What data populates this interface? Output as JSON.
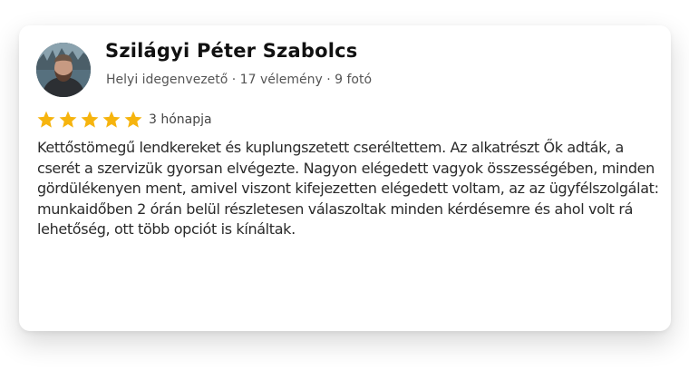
{
  "review": {
    "author": "Szilágyi Péter Szabolcs",
    "author_meta": "Helyi idegenvezető · 17 vélemény · 9 fotó",
    "rating": 5,
    "max_rating": 5,
    "date": "3 hónapja",
    "text": "Kettőstömegű lendkereket és kuplungszetett cseréltettem. Az alkatrészt Ők adták, a cserét a szervizük gyorsan elvégezte. Nagyon elégedett vagyok összességében, minden gördülékenyen ment, amivel viszont kifejezetten elégedett voltam, az az ügyfélszolgálat: munkaidőben 2 órán belül részletesen válaszoltak minden kérdésemre és ahol volt rá lehetőség, ott több opciót is kínáltak."
  },
  "colors": {
    "star": "#f6b40e",
    "name": "#111111",
    "meta": "#555555",
    "body_text": "#2a2a2a"
  },
  "icons": {
    "avatar": "user-avatar-photo",
    "star": "star-filled-icon"
  }
}
